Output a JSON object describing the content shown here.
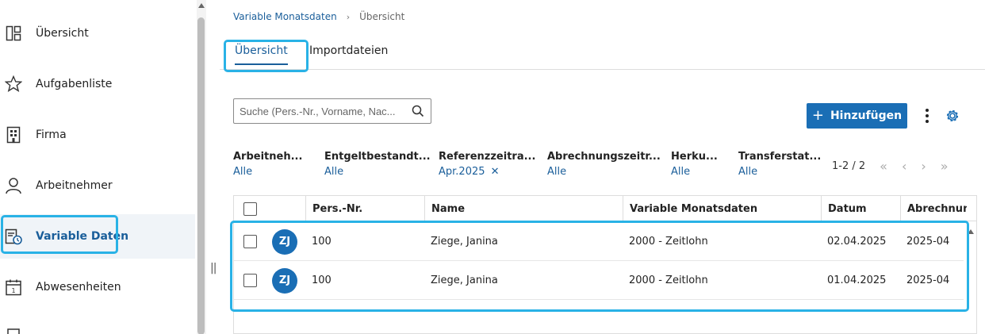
{
  "sidebar": {
    "items": [
      {
        "label": "Übersicht",
        "icon": "dashboard-icon"
      },
      {
        "label": "Aufgabenliste",
        "icon": "star-icon"
      },
      {
        "label": "Firma",
        "icon": "building-icon"
      },
      {
        "label": "Arbeitnehmer",
        "icon": "person-icon"
      },
      {
        "label": "Variable Daten",
        "icon": "variable-data-icon",
        "active": true
      },
      {
        "label": "Abwesenheiten",
        "icon": "calendar-icon"
      }
    ]
  },
  "breadcrumb": {
    "parent": "Variable Monatsdaten",
    "current": "Übersicht"
  },
  "tabs": [
    {
      "label": "Übersicht",
      "active": true
    },
    {
      "label": "Importdateien",
      "active": false
    }
  ],
  "toolbar": {
    "search_placeholder": "Suche (Pers.-Nr., Vorname, Nac...",
    "add_label": "Hinzufügen"
  },
  "filters": [
    {
      "label": "Arbeitneh...",
      "value": "Alle"
    },
    {
      "label": "Entgeltbestandt...",
      "value": "Alle"
    },
    {
      "label": "Referenzzeitra...",
      "value": "Apr.2025",
      "clearable": true
    },
    {
      "label": "Abrechnungszeitr...",
      "value": "Alle"
    },
    {
      "label": "Herku...",
      "value": "Alle"
    },
    {
      "label": "Transferstat...",
      "value": "Alle"
    }
  ],
  "pager": {
    "range": "1-2 / 2"
  },
  "table": {
    "columns": [
      "Pers.-Nr.",
      "Name",
      "Variable Monatsdaten",
      "Datum",
      "Abrechnun..."
    ],
    "rows": [
      {
        "initials": "ZJ",
        "pers_nr": "100",
        "name": "Ziege, Janina",
        "data": "2000 - Zeitlohn",
        "datum": "02.04.2025",
        "abrechnung": "2025-04"
      },
      {
        "initials": "ZJ",
        "pers_nr": "100",
        "name": "Ziege, Janina",
        "data": "2000 - Zeitlohn",
        "datum": "01.04.2025",
        "abrechnung": "2025-04"
      }
    ]
  },
  "colors": {
    "accent": "#1a5e9a",
    "button": "#1a6eb5",
    "highlight": "#29b2e6"
  }
}
